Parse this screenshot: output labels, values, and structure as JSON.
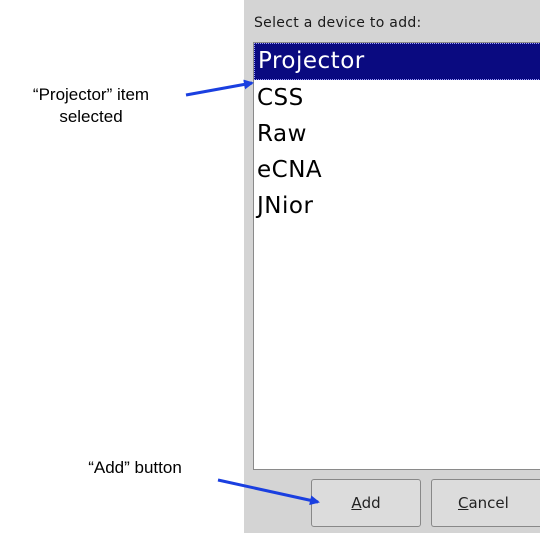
{
  "dialog": {
    "prompt": "Select a device to add:",
    "devices": [
      "Projector",
      "CSS",
      "Raw",
      "eCNA",
      "JNior"
    ],
    "selected": "Projector",
    "buttons": {
      "add": {
        "mnemonic": "A",
        "rest": "dd"
      },
      "cancel": {
        "mnemonic": "C",
        "rest": "ancel"
      }
    }
  },
  "annotations": {
    "projector_line1": "“Projector” item",
    "projector_line2": "selected",
    "add_button": "“Add” button"
  },
  "colors": {
    "selection": "#0a0a80",
    "arrow": "#1a3fe0",
    "dialog_bg": "#d4d4d4"
  }
}
